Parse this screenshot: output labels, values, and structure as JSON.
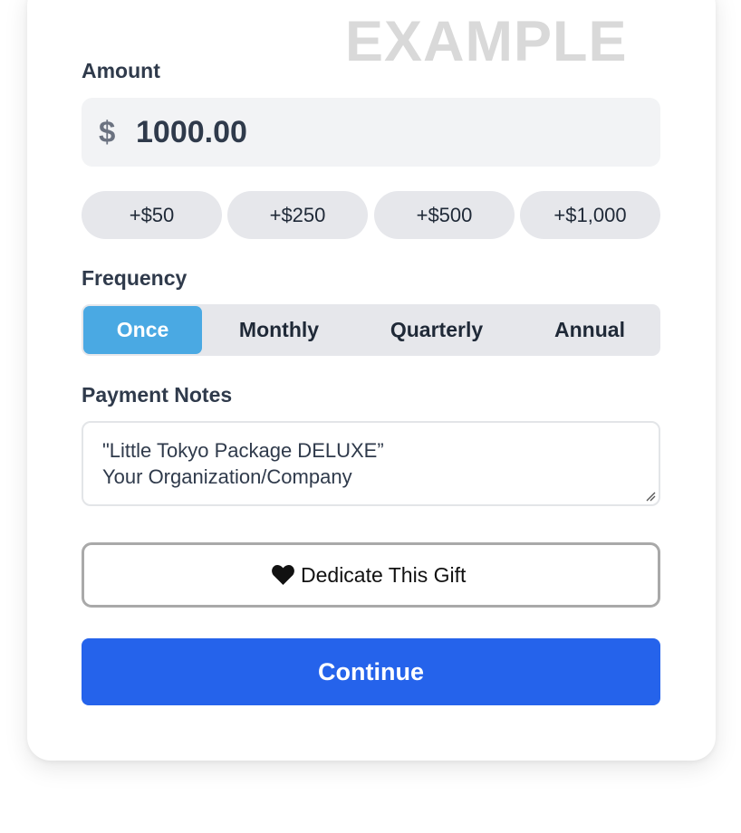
{
  "watermark": "EXAMPLE",
  "amount": {
    "label": "Amount",
    "currency_symbol": "$",
    "value": "1000.00"
  },
  "quick_amounts": [
    "+$50",
    "+$250",
    "+$500",
    "+$1,000"
  ],
  "frequency": {
    "label": "Frequency",
    "options": [
      "Once",
      "Monthly",
      "Quarterly",
      "Annual"
    ],
    "selected": "Once"
  },
  "payment_notes": {
    "label": "Payment Notes",
    "lines": [
      "\"Little Tokyo Package DELUXE”",
      "Your Organization/Company"
    ]
  },
  "dedicate": {
    "icon": "heart-icon",
    "label": "Dedicate This Gift"
  },
  "continue_label": "Continue",
  "colors": {
    "primary": "#2563eb",
    "selected_tab": "#4aa9e3",
    "chip_bg": "#e6e7eb"
  }
}
